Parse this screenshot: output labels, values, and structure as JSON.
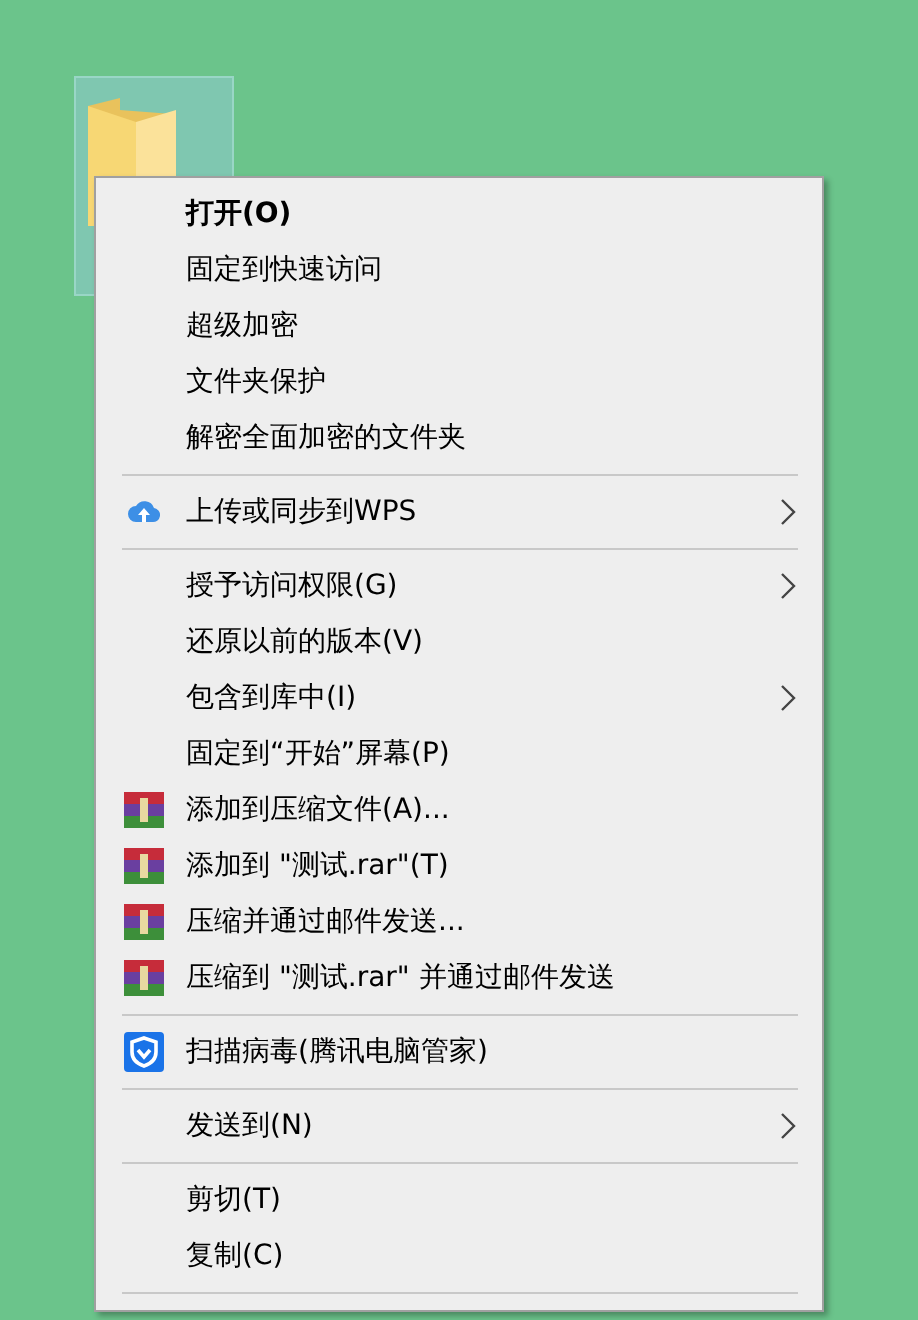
{
  "desktop": {
    "selected_folder": {
      "selected": true
    }
  },
  "context_menu": {
    "items": [
      {
        "kind": "plain",
        "label": "打开(O)",
        "bold": true
      },
      {
        "kind": "plain",
        "label": "固定到快速访问"
      },
      {
        "kind": "plain",
        "label": "超级加密"
      },
      {
        "kind": "plain",
        "label": "文件夹保护"
      },
      {
        "kind": "plain",
        "label": "解密全面加密的文件夹"
      },
      {
        "kind": "separator"
      },
      {
        "kind": "cloud",
        "label": "上传或同步到WPS",
        "submenu": true
      },
      {
        "kind": "separator"
      },
      {
        "kind": "plain",
        "label": "授予访问权限(G)",
        "submenu": true
      },
      {
        "kind": "plain",
        "label": "还原以前的版本(V)"
      },
      {
        "kind": "plain",
        "label": "包含到库中(I)",
        "submenu": true
      },
      {
        "kind": "plain",
        "label": "固定到“开始”屏幕(P)"
      },
      {
        "kind": "archive",
        "label": "添加到压缩文件(A)..."
      },
      {
        "kind": "archive",
        "label": "添加到 \"测试.rar\"(T)"
      },
      {
        "kind": "archive",
        "label": "压缩并通过邮件发送..."
      },
      {
        "kind": "archive",
        "label": "压缩到 \"测试.rar\" 并通过邮件发送"
      },
      {
        "kind": "separator"
      },
      {
        "kind": "shield",
        "label": "扫描病毒(腾讯电脑管家)"
      },
      {
        "kind": "separator"
      },
      {
        "kind": "plain",
        "label": "发送到(N)",
        "submenu": true
      },
      {
        "kind": "separator"
      },
      {
        "kind": "plain",
        "label": "剪切(T)"
      },
      {
        "kind": "plain",
        "label": "复制(C)"
      },
      {
        "kind": "separator"
      }
    ]
  }
}
